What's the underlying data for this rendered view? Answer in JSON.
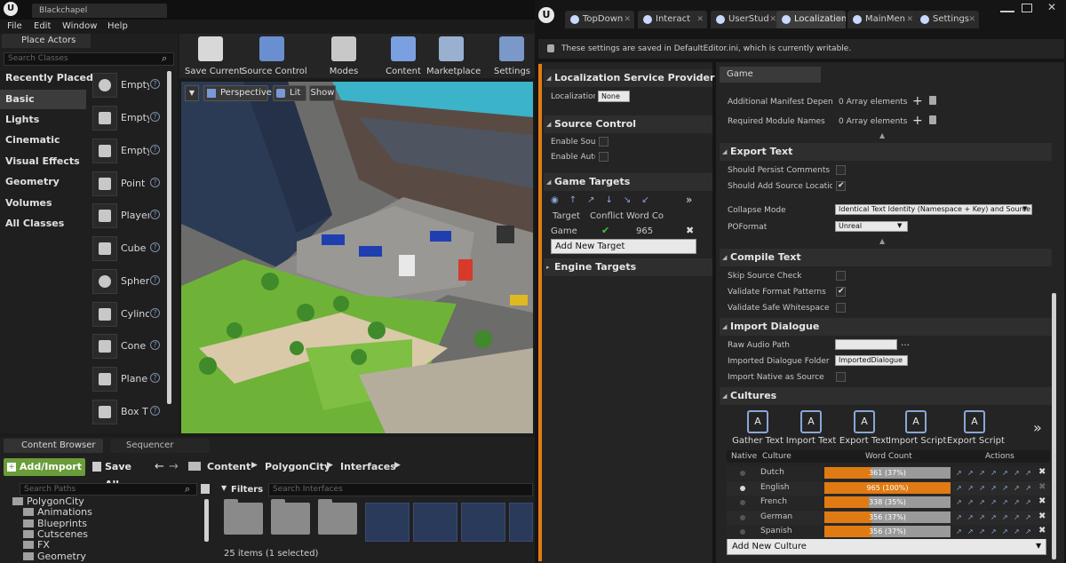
{
  "left_window": {
    "title": "Blackchapel",
    "menu": [
      "File",
      "Edit",
      "Window",
      "Help"
    ]
  },
  "place_actors": {
    "tab": "Place Actors",
    "search_placeholder": "Search Classes",
    "categories": [
      "Recently Placed",
      "Basic",
      "Lights",
      "Cinematic",
      "Visual Effects",
      "Geometry",
      "Volumes",
      "All Classes"
    ],
    "actors": [
      "Empty",
      "Empty",
      "Empty",
      "Point",
      "Player",
      "Cube",
      "Spher",
      "Cylinc",
      "Cone",
      "Plane",
      "Box T"
    ]
  },
  "toolbar": {
    "buttons": [
      "Save Current",
      "Source Control",
      "Modes",
      "Content",
      "Marketplace",
      "Settings"
    ]
  },
  "viewport": {
    "perspective": "Perspective",
    "lit": "Lit",
    "show": "Show"
  },
  "content_browser": {
    "tab": "Content Browser",
    "seq_tab": "Sequencer",
    "add_import": "Add/Import",
    "save_all": "Save All",
    "path": [
      "Content",
      "PolygonCity",
      "Interfaces"
    ],
    "search_paths": "Search Paths",
    "filters": "Filters",
    "search_interfaces": "Search Interfaces",
    "tree": [
      "PolygonCity",
      "Animations",
      "Blueprints",
      "Cutscenes",
      "FX",
      "Geometry"
    ],
    "status": "25 items (1 selected)"
  },
  "right_window": {
    "tabs": [
      "TopDown",
      "Interact",
      "UserStud",
      "Localization",
      "MainMen",
      "Settings"
    ],
    "notice": "These settings are saved in DefaultEditor.ini, which is currently writable."
  },
  "left_panel": {
    "loc_service": {
      "header": "Localization Service Provider",
      "label": "Localization S",
      "value": "None"
    },
    "source_control": {
      "header": "Source Control",
      "items": [
        "Enable Source",
        "Enable Auto S"
      ]
    },
    "game_targets": {
      "header": "Game Targets",
      "cols": [
        "Target",
        "Conflict",
        "Word Co"
      ],
      "row": {
        "target": "Game",
        "words": "965"
      },
      "add": "Add New Target"
    },
    "engine_targets": {
      "header": "Engine Targets"
    }
  },
  "right_panel": {
    "tab": "Game",
    "manifest": [
      {
        "label": "Additional Manifest Dependencie",
        "value": "0 Array elements"
      },
      {
        "label": "Required Module Names",
        "value": "0 Array elements"
      }
    ],
    "export_text": {
      "header": "Export Text",
      "items": [
        {
          "label": "Should Persist Comments on Exp",
          "checked": false
        },
        {
          "label": "Should Add Source Locations as",
          "checked": true
        }
      ],
      "collapse_label": "Collapse Mode",
      "collapse_value": "Identical Text Identity (Namespace + Key) and Source Tex",
      "poformat_label": "POFormat",
      "poformat_value": "Unreal"
    },
    "compile_text": {
      "header": "Compile Text",
      "items": [
        {
          "label": "Skip Source Check",
          "checked": false
        },
        {
          "label": "Validate Format Patterns",
          "checked": true
        },
        {
          "label": "Validate Safe Whitespace",
          "checked": false
        }
      ]
    },
    "import_dialogue": {
      "header": "Import Dialogue",
      "raw_label": "Raw Audio Path",
      "raw_value": "",
      "folder_label": "Imported Dialogue Folder",
      "folder_value": "ImportedDialogue",
      "native_label": "Import Native as Source"
    },
    "cultures": {
      "header": "Cultures",
      "actions": [
        "Gather Text",
        "Import Text",
        "Export Text",
        "Import Script",
        "Export Script"
      ],
      "cols": [
        "Native",
        "Culture",
        "Word Count",
        "Actions"
      ],
      "rows": [
        {
          "name": "Dutch",
          "text": "361 (37%)",
          "pct": 0.37
        },
        {
          "name": "English",
          "text": "965 (100%)",
          "pct": 1.0
        },
        {
          "name": "French",
          "text": "338 (35%)",
          "pct": 0.35
        },
        {
          "name": "German",
          "text": "356 (37%)",
          "pct": 0.37
        },
        {
          "name": "Spanish",
          "text": "356 (37%)",
          "pct": 0.37
        }
      ],
      "add": "Add New Culture"
    }
  },
  "colors": {
    "accent_orange": "#e07b14",
    "add_green": "#6a9c3a",
    "dark_bg": "#151515",
    "panel_bg": "#242424"
  }
}
